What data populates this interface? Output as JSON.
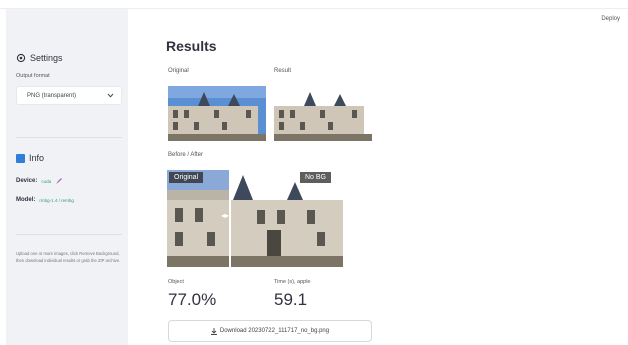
{
  "header": {
    "deploy_label": "Deploy"
  },
  "sidebar": {
    "settings_title": "Settings",
    "output_format_label": "Output format",
    "output_format_value": "PNG (transparent)",
    "info_title": "Info",
    "device_label": "Device:",
    "device_value": "cuda",
    "model_label": "Model:",
    "model_value": "rmbg-1.4 / rembg",
    "note": "Upload one or more images, click Remove Background, then download individual results or grab the ZIP archive."
  },
  "main": {
    "title": "Results",
    "original_caption": "Original",
    "result_caption": "Result",
    "before_after_caption": "Before / After",
    "before_tag": "Original",
    "after_tag": "No BG",
    "metrics": [
      {
        "label": "Object",
        "value": "77.0%"
      },
      {
        "label": "Time (s), apple",
        "value": "59.1"
      }
    ],
    "download_label": "Download 20230722_111717_no_bg.png"
  },
  "colors": {
    "sidebar_bg": "#f0f2f6",
    "accent": "#2f7fd8",
    "sky": "#5a8fd4"
  }
}
